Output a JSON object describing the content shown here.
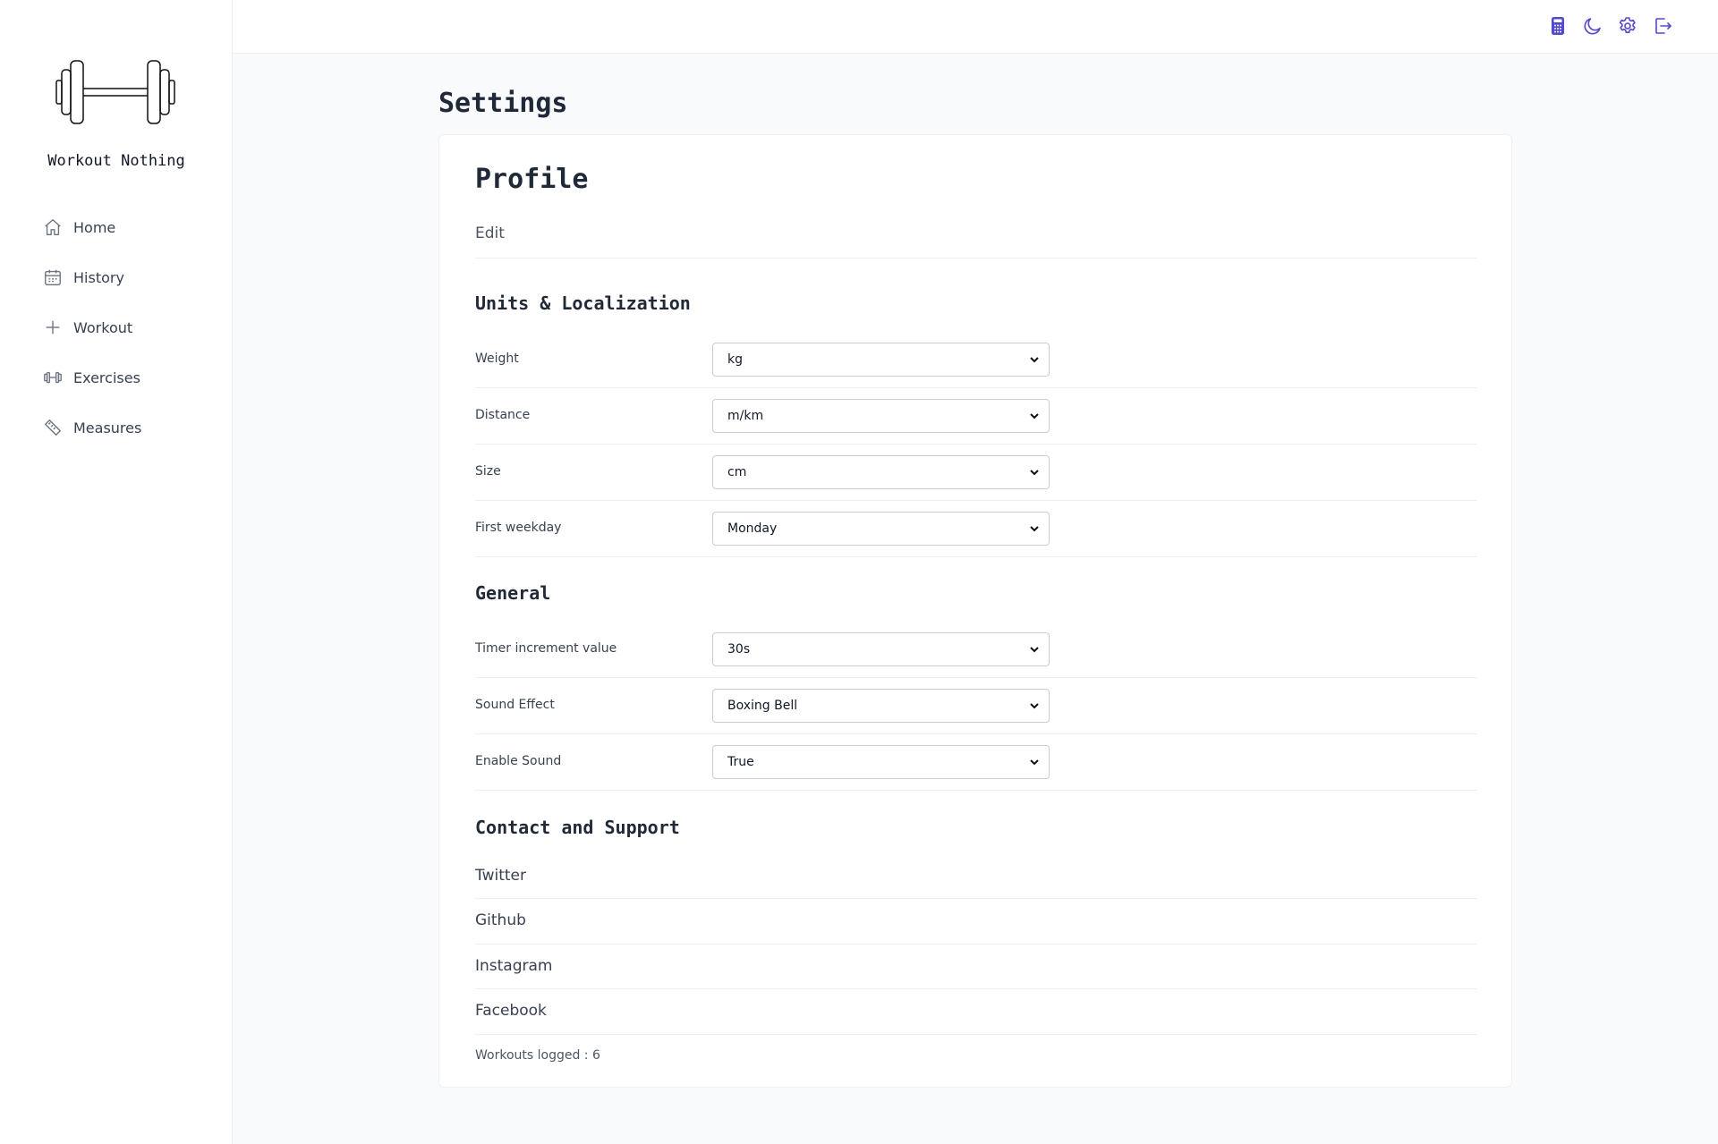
{
  "sidebar": {
    "app_title": "Workout Nothing",
    "items": [
      {
        "label": "Home",
        "icon": "home-icon"
      },
      {
        "label": "History",
        "icon": "calendar-icon"
      },
      {
        "label": "Workout",
        "icon": "plus-icon"
      },
      {
        "label": "Exercises",
        "icon": "dumbbell-icon"
      },
      {
        "label": "Measures",
        "icon": "ruler-icon"
      }
    ]
  },
  "topbar": {
    "icons": [
      "calculator-icon",
      "moon-icon",
      "gear-icon",
      "logout-icon"
    ],
    "accent_color": "#5046e5"
  },
  "page": {
    "title": "Settings"
  },
  "profile": {
    "title": "Profile",
    "edit_label": "Edit"
  },
  "units": {
    "title": "Units & Localization",
    "rows": [
      {
        "label": "Weight",
        "value": "kg"
      },
      {
        "label": "Distance",
        "value": "m/km"
      },
      {
        "label": "Size",
        "value": "cm"
      },
      {
        "label": "First weekday",
        "value": "Monday"
      }
    ]
  },
  "general": {
    "title": "General",
    "rows": [
      {
        "label": "Timer increment value",
        "value": "30s"
      },
      {
        "label": "Sound Effect",
        "value": "Boxing Bell"
      },
      {
        "label": "Enable Sound",
        "value": "True"
      }
    ]
  },
  "contact": {
    "title": "Contact and Support",
    "links": [
      "Twitter",
      "Github",
      "Instagram",
      "Facebook"
    ]
  },
  "footer": {
    "workouts_logged": "Workouts logged : 6"
  }
}
